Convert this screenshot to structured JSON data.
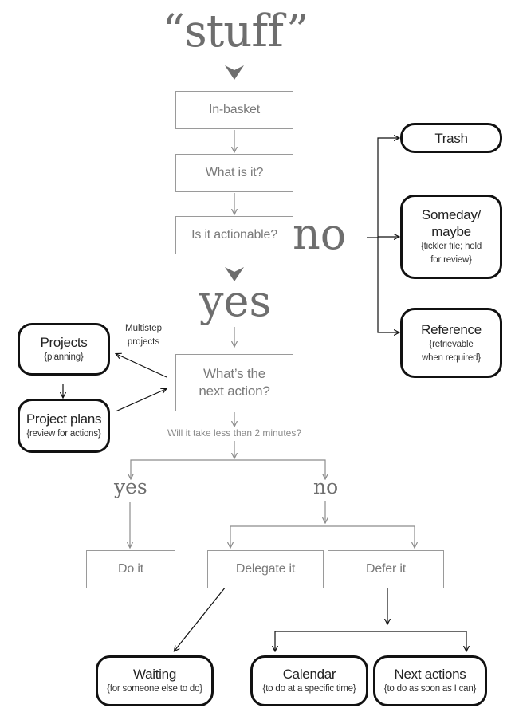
{
  "title": "“stuff”",
  "flow": {
    "in_basket": "In-basket",
    "what_is_it": "What is it?",
    "is_actionable": "Is it actionable?",
    "no_label": "no",
    "yes_label": "yes",
    "next_action": [
      "What’s the",
      "next action?"
    ],
    "two_minutes_question": "Will it take less than 2 minutes?",
    "yes_small": "yes",
    "no_small": "no",
    "do_it": "Do it",
    "delegate_it": "Delegate it",
    "defer_it": "Defer it",
    "multistep_label": [
      "Multistep",
      "projects"
    ]
  },
  "non_actionable": {
    "trash": {
      "title": "Trash"
    },
    "someday": {
      "title": [
        "Someday/",
        "maybe"
      ],
      "subtitle": [
        "{tickler file; hold",
        "for review}"
      ]
    },
    "reference": {
      "title": "Reference",
      "subtitle": [
        "{retrievable",
        "when required}"
      ]
    }
  },
  "projects": {
    "projects": {
      "title": "Projects",
      "subtitle": "{planning}"
    },
    "project_plans": {
      "title": "Project plans",
      "subtitle": "{review for actions}"
    }
  },
  "outcomes": {
    "waiting": {
      "title": "Waiting",
      "subtitle": "{for someone else to do}"
    },
    "calendar": {
      "title": "Calendar",
      "subtitle": "{to do at a specific time}"
    },
    "next_actions": {
      "title": "Next actions",
      "subtitle": "{to do as soon as I can}"
    }
  },
  "colors": {
    "gray_text": "#7a7a7a",
    "gray_line": "#8c8c8c",
    "dark_line": "#111111"
  }
}
